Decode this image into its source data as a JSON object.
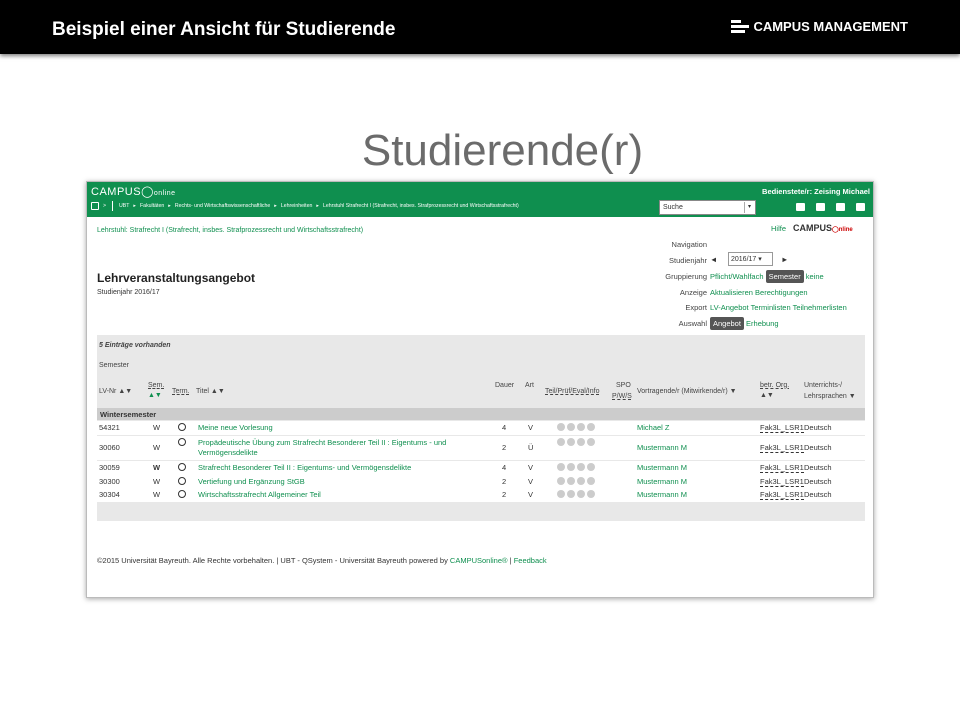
{
  "slide": {
    "title": "Beispiel einer Ansicht für Studierende",
    "logo": "CAMPUS MANAGEMENT",
    "heading": "Studierende(r)"
  },
  "app": {
    "brand": "CAMPUS",
    "brand_sup": "online",
    "user": "Bedienstete/r: Zeising Michael",
    "breadcrumb": [
      "UBT",
      "Fakultäten",
      "Rechts- und Wirtschaftswissenschaftliche",
      "Lehreinheiten",
      "Lehrstuhl Strafrecht I (Strafrecht, insbes. Strafprozessrecht und Wirtschaftsstrafrecht)"
    ],
    "search_value": "Suche"
  },
  "crumb_title": "Lehrstuhl: Strafrecht I (Strafrecht, insbes. Strafprozessrecht und Wirtschaftsstrafrecht)",
  "help": "Hilfe",
  "co_logo": "CAMPUSonline",
  "nav": {
    "label": "Navigation",
    "studienjahr_label": "Studienjahr",
    "year": "2016/17",
    "grup_label": "Gruppierung",
    "grup_opts": [
      "Pflicht/Wahlfach",
      "Semester",
      "keine"
    ],
    "anz_label": "Anzeige",
    "anz_opts": [
      "Aktualisieren",
      "Berechtigungen"
    ],
    "exp_label": "Export",
    "exp_opts": [
      "LV-Angebot",
      "Terminlisten",
      "Teilnehmerlisten"
    ],
    "aus_label": "Auswahl",
    "aus_opts": [
      "Angebot",
      "Erhebung"
    ]
  },
  "page": {
    "title": "Lehrveranstaltungsangebot",
    "subtitle": "Studienjahr 2016/17"
  },
  "table": {
    "count": "5 Einträge vorhanden",
    "group_label": "Semester",
    "headers": {
      "lvnr": "LV-Nr",
      "sem": "Sem.",
      "term": "Term.",
      "titel": "Titel",
      "dauer": "Dauer",
      "art": "Art",
      "teil": "Teil/Prüf/Eval/Info",
      "spo": "SPO",
      "pws": "P/W/S",
      "vortr": "Vortragende/r (Mitwirkende/r)",
      "org": "betr. Org.",
      "spr1": "Unterrichts-/",
      "spr2": "Lehrsprachen"
    },
    "section": "Wintersemester",
    "rows": [
      {
        "nr": "54321",
        "sem": "W",
        "titel": "Meine neue Vorlesung",
        "dauer": "4",
        "art": "V",
        "vortr": "Michael Z",
        "org": "Fak3L_LSR1",
        "spr": "Deutsch"
      },
      {
        "nr": "30060",
        "sem": "W",
        "titel": "Propädeutische Übung zum Strafrecht Besonderer Teil II : Eigentums - und",
        "titel2": "Vermögensdelikte",
        "dauer": "2",
        "art": "Ü",
        "vortr": "Mustermann M",
        "org": "Fak3L_LSR1",
        "spr": "Deutsch"
      },
      {
        "nr": "30059",
        "sem": "W",
        "titel": "Strafrecht Besonderer Teil II : Eigentums- und Vermögensdelikte",
        "dauer": "4",
        "art": "V",
        "vortr": "Mustermann M",
        "org": "Fak3L_LSR1",
        "spr": "Deutsch"
      },
      {
        "nr": "30300",
        "sem": "W",
        "titel": "Vertiefung und Ergänzung StGB",
        "dauer": "2",
        "art": "V",
        "vortr": "Mustermann M",
        "org": "Fak3L_LSR1",
        "spr": "Deutsch"
      },
      {
        "nr": "30304",
        "sem": "W",
        "titel": "Wirtschaftsstrafrecht Allgemeiner Teil",
        "dauer": "2",
        "art": "V",
        "vortr": "Mustermann M",
        "org": "Fak3L_LSR1",
        "spr": "Deutsch"
      }
    ]
  },
  "footer": {
    "text": "©2015 Universität Bayreuth. Alle Rechte vorbehalten. | UBT - QSystem - Universität Bayreuth powered by ",
    "link": "CAMPUSonline®",
    "sep": " | ",
    "feedback": "Feedback"
  }
}
